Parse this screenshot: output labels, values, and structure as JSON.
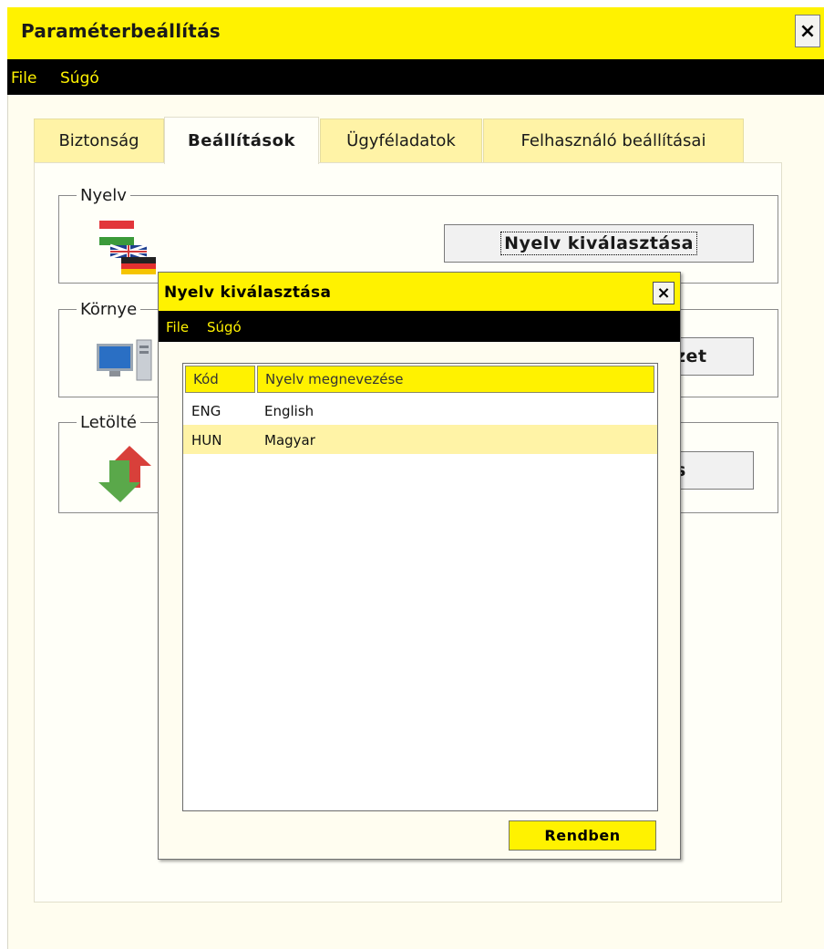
{
  "window": {
    "title": "Paraméterbeállítás",
    "close_glyph": "✕"
  },
  "menu": {
    "items": [
      "File",
      "Súgó"
    ]
  },
  "tabs": [
    "Biztonság",
    "Beállítások",
    "Ügyféladatok",
    "Felhasználó beállításai"
  ],
  "active_tab": "Beállítások",
  "groups": {
    "nyelv": {
      "legend": "Nyelv",
      "button": "Nyelv kiválasztása",
      "icon": "flags-icon"
    },
    "kornyezet": {
      "legend": "Környe",
      "button": "zet",
      "icon": "computer-icon"
    },
    "letoltes": {
      "legend": "Letölté",
      "button": "s",
      "icon": "transfer-arrows-icon"
    }
  },
  "dialog": {
    "title": "Nyelv kiválasztása",
    "close_glyph": "✕",
    "menu": [
      "File",
      "Súgó"
    ],
    "columns": [
      "Kód",
      "Nyelv megnevezése"
    ],
    "rows": [
      {
        "code": "ENG",
        "name": "English"
      },
      {
        "code": "HUN",
        "name": "Magyar"
      }
    ],
    "selected_row": "HUN",
    "ok_button": "Rendben"
  },
  "colors": {
    "accent": "#fff200",
    "menubar": "#000000",
    "selected_row": "#fff3a6"
  }
}
